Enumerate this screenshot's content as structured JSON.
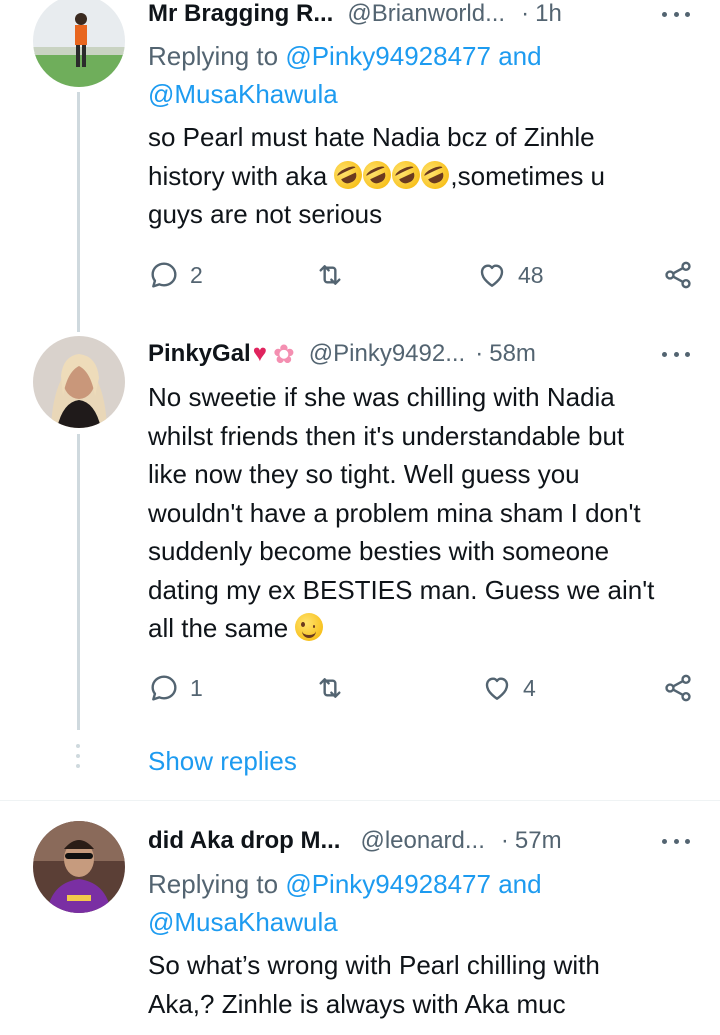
{
  "tweets": [
    {
      "name": "Mr Bragging R...",
      "handle": "@Brianworld...",
      "time": "1h",
      "replying_prefix": "Replying to ",
      "replying_to_1": "@Pinky94928477",
      "replying_and": " and",
      "replying_to_2": "@MusaKhawula",
      "text_line1": "so Pearl must hate Nadia bcz of Zinhle",
      "text_line2a": "history with aka ",
      "text_line2b": ",sometimes u",
      "text_line3": "guys are not serious",
      "emojis": [
        "rolling-on-floor-laughing",
        "rolling-on-floor-laughing",
        "rolling-on-floor-laughing",
        "rolling-on-floor-laughing"
      ],
      "replies": "2",
      "retweets": "",
      "likes": "48"
    },
    {
      "name": "PinkyGal",
      "name_emojis": [
        "red-heart",
        "cherry-blossom"
      ],
      "handle": "@Pinky9492...",
      "time": "58m",
      "text_lines": [
        "No sweetie if she was chilling with Nadia",
        "whilst friends then it's understandable but",
        "like now they so tight. Well guess you",
        "wouldn't have a problem mina sham I don't",
        "suddenly become besties with someone",
        "dating my ex  BESTIES man. Guess we ain't"
      ],
      "text_last": "all the same ",
      "trailing_emoji": "winking-face",
      "replies": "1",
      "retweets": "",
      "likes": "4"
    },
    {
      "name": "did Aka drop M...",
      "handle": "@leonard...",
      "time": "57m",
      "replying_prefix": "Replying to ",
      "replying_to_1": "@Pinky94928477",
      "replying_and": " and",
      "replying_to_2": "@MusaKhawula",
      "text_line1": "So what’s wrong with Pearl chilling with",
      "text_line2": "Aka,? Zinhle is always with Aka muc"
    }
  ],
  "dot_separator": "·",
  "show_replies_label": "Show replies",
  "colors": {
    "accent": "#1d9bf0",
    "muted": "#536471",
    "text": "#0f1419",
    "thread_line": "#cfd9de"
  }
}
